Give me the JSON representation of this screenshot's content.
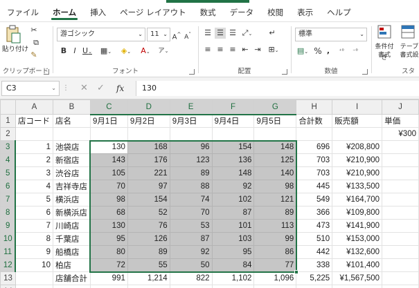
{
  "tabs": [
    "ファイル",
    "ホーム",
    "挿入",
    "ページ レイアウト",
    "数式",
    "データ",
    "校閲",
    "表示",
    "ヘルプ"
  ],
  "active_tab": "ホーム",
  "ribbon": {
    "clipboard": {
      "paste": "貼り付け",
      "label": "クリップボード"
    },
    "font": {
      "name": "游ゴシック",
      "size": "11",
      "label": "フォント",
      "grow": "A^",
      "shrink": "A˅"
    },
    "alignment": {
      "label": "配置"
    },
    "number": {
      "format": "標準",
      "label": "数値",
      "percent": "%"
    },
    "styles": {
      "conditional": "条件付き",
      "conditional2": "書式",
      "table": "テーブ",
      "table2": "書式設",
      "label": "スタ"
    }
  },
  "formula_bar": {
    "name_box": "C3",
    "fx": "fx",
    "value": "130"
  },
  "columns": [
    "A",
    "B",
    "C",
    "D",
    "E",
    "F",
    "G",
    "H",
    "I",
    "J"
  ],
  "rows": [
    {
      "n": "1",
      "cells": [
        "店コード",
        "店名",
        "9月1日",
        "9月2日",
        "9月3日",
        "9月4日",
        "9月5日",
        "合計数",
        "販売額",
        "単価"
      ]
    },
    {
      "n": "2",
      "cells": [
        "",
        "",
        "",
        "",
        "",
        "",
        "",
        "",
        "",
        "¥300"
      ]
    },
    {
      "n": "3",
      "cells": [
        "1",
        "池袋店",
        "130",
        "168",
        "96",
        "154",
        "148",
        "696",
        "¥208,800",
        ""
      ]
    },
    {
      "n": "4",
      "cells": [
        "2",
        "新宿店",
        "143",
        "176",
        "123",
        "136",
        "125",
        "703",
        "¥210,900",
        ""
      ]
    },
    {
      "n": "5",
      "cells": [
        "3",
        "渋谷店",
        "105",
        "221",
        "89",
        "148",
        "140",
        "703",
        "¥210,900",
        ""
      ]
    },
    {
      "n": "6",
      "cells": [
        "4",
        "吉祥寺店",
        "70",
        "97",
        "88",
        "92",
        "98",
        "445",
        "¥133,500",
        ""
      ]
    },
    {
      "n": "7",
      "cells": [
        "5",
        "横浜店",
        "98",
        "154",
        "74",
        "102",
        "121",
        "549",
        "¥164,700",
        ""
      ]
    },
    {
      "n": "8",
      "cells": [
        "6",
        "新横浜店",
        "68",
        "52",
        "70",
        "87",
        "89",
        "366",
        "¥109,800",
        ""
      ]
    },
    {
      "n": "9",
      "cells": [
        "7",
        "川崎店",
        "130",
        "76",
        "53",
        "101",
        "113",
        "473",
        "¥141,900",
        ""
      ]
    },
    {
      "n": "10",
      "cells": [
        "8",
        "千葉店",
        "95",
        "126",
        "87",
        "103",
        "99",
        "510",
        "¥153,000",
        ""
      ]
    },
    {
      "n": "11",
      "cells": [
        "9",
        "船橋店",
        "80",
        "89",
        "92",
        "95",
        "86",
        "442",
        "¥132,600",
        ""
      ]
    },
    {
      "n": "12",
      "cells": [
        "10",
        "柏店",
        "72",
        "55",
        "50",
        "84",
        "77",
        "338",
        "¥101,400",
        ""
      ]
    },
    {
      "n": "13",
      "cells": [
        "",
        "店舗合計",
        "991",
        "1,214",
        "822",
        "1,102",
        "1,096",
        "5,225",
        "¥1,567,500",
        ""
      ]
    },
    {
      "n": "14",
      "cells": [
        "",
        "",
        "",
        "",
        "",
        "",
        "",
        "",
        "",
        ""
      ]
    }
  ],
  "colors": {
    "accent": "#217346",
    "selection": "#c6c6c6"
  }
}
